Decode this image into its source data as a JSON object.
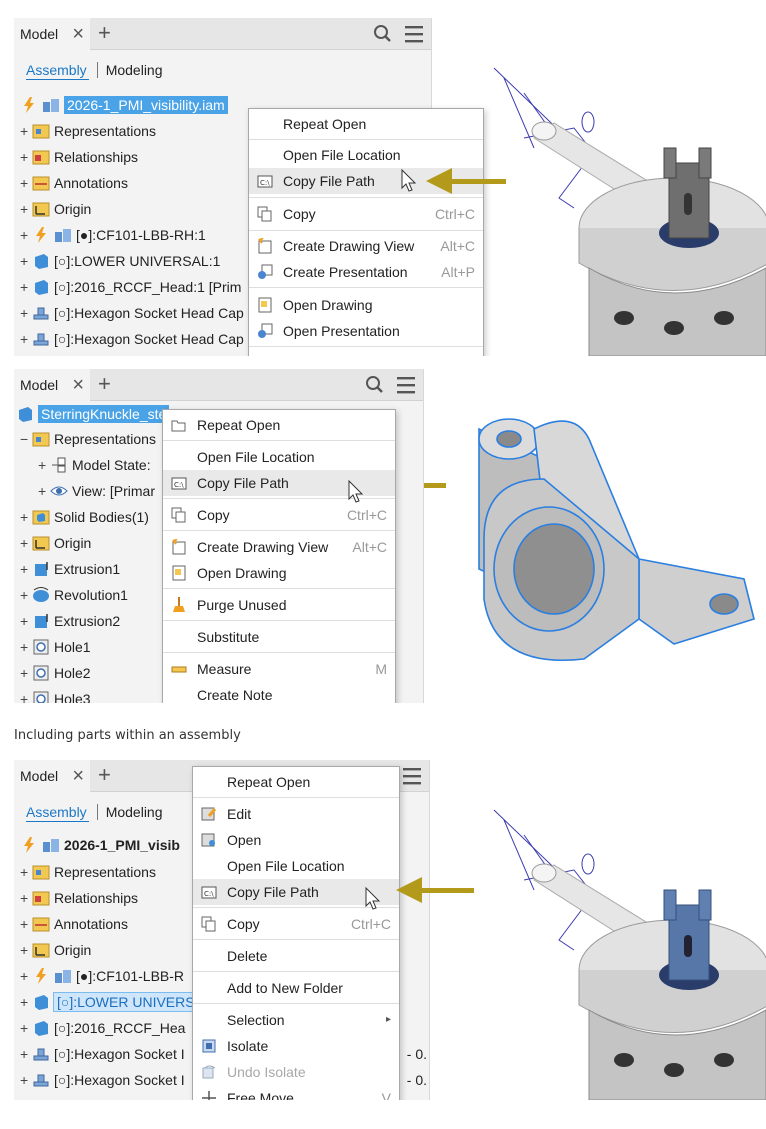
{
  "shot1": {
    "panel": {
      "tab": "Model",
      "subtabs": [
        "Assembly",
        "Modeling"
      ],
      "tree": [
        {
          "label": "2026-1_PMI_visibility.iam",
          "selected": true
        },
        {
          "label": "Representations"
        },
        {
          "label": "Relationships"
        },
        {
          "label": "Annotations"
        },
        {
          "label": "Origin"
        },
        {
          "label": "[●]:CF101-LBB-RH:1"
        },
        {
          "label": "[○]:LOWER UNIVERSAL:1"
        },
        {
          "label": "[○]:2016_RCCF_Head:1 [Prim"
        },
        {
          "label": "[○]:Hexagon Socket Head Cap"
        },
        {
          "label": "[○]:Hexagon Socket Head Cap"
        }
      ]
    },
    "menu": [
      {
        "label": "Repeat Open",
        "shortcut": ""
      },
      {
        "label": "Open File Location",
        "shortcut": ""
      },
      {
        "label": "Copy File Path",
        "shortcut": "",
        "highlight": true
      },
      {
        "label": "Copy",
        "shortcut": "Ctrl+C"
      },
      {
        "label": "Create Drawing View",
        "shortcut": "Alt+C"
      },
      {
        "label": "Create Presentation",
        "shortcut": "Alt+P"
      },
      {
        "label": "Open Drawing",
        "shortcut": ""
      },
      {
        "label": "Open Presentation",
        "shortcut": ""
      }
    ]
  },
  "shot2": {
    "panel": {
      "tab": "Model",
      "tree": [
        {
          "label": "SterringKnuckle_ste",
          "selected": true
        },
        {
          "label": "Representations"
        },
        {
          "label": "Model State:"
        },
        {
          "label": "View: [Primar"
        },
        {
          "label": "Solid Bodies(1)"
        },
        {
          "label": "Origin"
        },
        {
          "label": "Extrusion1"
        },
        {
          "label": "Revolution1"
        },
        {
          "label": "Extrusion2"
        },
        {
          "label": "Hole1"
        },
        {
          "label": "Hole2"
        },
        {
          "label": "Hole3"
        }
      ]
    },
    "menu": [
      {
        "label": "Repeat Open",
        "shortcut": ""
      },
      {
        "label": "Open File Location",
        "shortcut": ""
      },
      {
        "label": "Copy File Path",
        "shortcut": "",
        "highlight": true
      },
      {
        "label": "Copy",
        "shortcut": "Ctrl+C"
      },
      {
        "label": "Create Drawing View",
        "shortcut": "Alt+C"
      },
      {
        "label": "Open Drawing",
        "shortcut": ""
      },
      {
        "label": "Purge Unused",
        "shortcut": ""
      },
      {
        "label": "Substitute",
        "shortcut": ""
      },
      {
        "label": "Measure",
        "shortcut": "M"
      },
      {
        "label": "Create Note",
        "shortcut": ""
      }
    ]
  },
  "caption": "Including parts within an assembly",
  "shot3": {
    "panel": {
      "tab": "Model",
      "subtabs": [
        "Assembly",
        "Modeling"
      ],
      "tree": [
        {
          "label": "2026-1_PMI_visib"
        },
        {
          "label": "Representations"
        },
        {
          "label": "Relationships"
        },
        {
          "label": "Annotations"
        },
        {
          "label": "Origin"
        },
        {
          "label": "[●]:CF101-LBB-R"
        },
        {
          "label": "[○]:LOWER UNIVERS",
          "selected": true
        },
        {
          "label": "[○]:2016_RCCF_Hea"
        },
        {
          "label": "[○]:Hexagon Socket I"
        },
        {
          "label": "[○]:Hexagon Socket I"
        }
      ],
      "partial": [
        "- 0.",
        "- 0."
      ]
    },
    "menu": [
      {
        "label": "Repeat Open",
        "shortcut": ""
      },
      {
        "label": "Edit",
        "shortcut": ""
      },
      {
        "label": "Open",
        "shortcut": ""
      },
      {
        "label": "Open File Location",
        "shortcut": ""
      },
      {
        "label": "Copy File Path",
        "shortcut": "",
        "highlight": true
      },
      {
        "label": "Copy",
        "shortcut": "Ctrl+C"
      },
      {
        "label": "Delete",
        "shortcut": ""
      },
      {
        "label": "Add to New Folder",
        "shortcut": ""
      },
      {
        "label": "Selection",
        "shortcut": "▸"
      },
      {
        "label": "Isolate",
        "shortcut": ""
      },
      {
        "label": "Undo Isolate",
        "shortcut": "",
        "disabled": true
      },
      {
        "label": "Free Move",
        "shortcut": "V"
      }
    ]
  },
  "colors": {
    "accent": "#1b78c7",
    "selection": "#4aa3e6",
    "arrow": "#b39a1a",
    "annotation": "#3b3bb0"
  }
}
